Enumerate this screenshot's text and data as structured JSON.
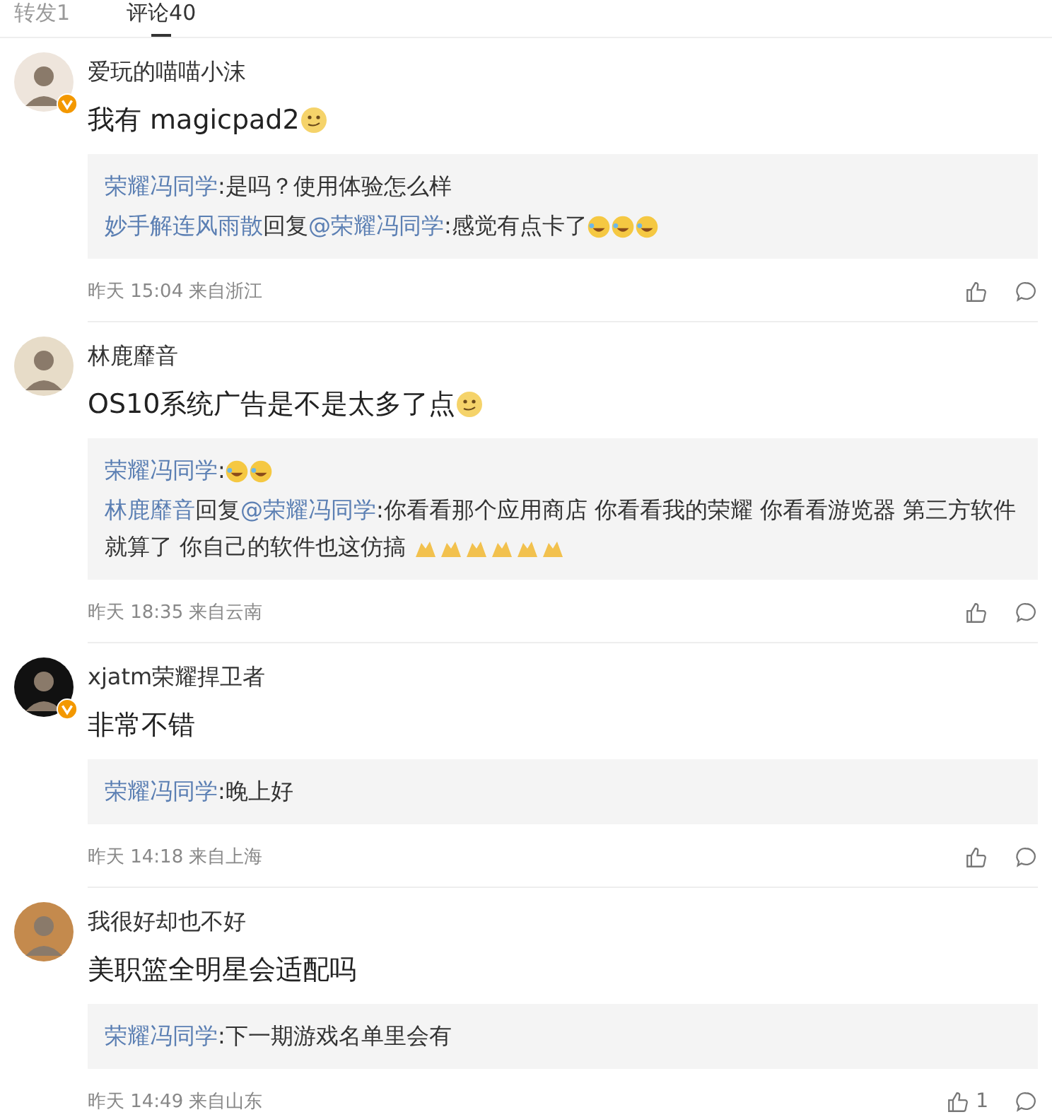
{
  "tabs": [
    {
      "label": "转发1",
      "selected": false
    },
    {
      "label": "评论40",
      "selected": true
    }
  ],
  "comments": [
    {
      "user": "爱玩的喵喵小沫",
      "verified": true,
      "avatar": {
        "color": "#eee5dc"
      },
      "text": "我有 magicpad2",
      "emojis": [
        {
          "kind": "smirk"
        }
      ],
      "replies": [
        {
          "author": "荣耀冯同学",
          "text": ":是吗？使用体验怎么样"
        },
        {
          "author": "妙手解连风雨散",
          "reply_label": "回复",
          "reply_to": "@荣耀冯同学",
          "text": ":感觉有点卡了",
          "emojis": [
            {
              "kind": "laugh"
            },
            {
              "kind": "laugh"
            },
            {
              "kind": "laugh"
            }
          ]
        }
      ],
      "meta": "昨天 15:04 来自浙江"
    },
    {
      "user": "林鹿靡音",
      "verified": false,
      "avatar": {
        "color": "#e7dcc8"
      },
      "text": "OS10系统广告是不是太多了点",
      "emojis": [
        {
          "kind": "smirk"
        }
      ],
      "replies": [
        {
          "author": "荣耀冯同学",
          "text": ":",
          "emojis": [
            {
              "kind": "laugh"
            },
            {
              "kind": "laugh"
            }
          ]
        },
        {
          "author": "林鹿靡音",
          "reply_label": "回复",
          "reply_to": "@荣耀冯同学",
          "text": ":你看看那个应用商店 你看看我的荣耀 你看看游览器 第三方软件就算了 你自己的软件也这仿搞 ",
          "emojis": [
            {
              "kind": "clap"
            },
            {
              "kind": "clap"
            },
            {
              "kind": "clap"
            },
            {
              "kind": "clap"
            },
            {
              "kind": "clap"
            },
            {
              "kind": "clap"
            }
          ]
        }
      ],
      "meta": "昨天 18:35 来自云南"
    },
    {
      "user": "xjatm荣耀捍卫者",
      "verified": true,
      "avatar": {
        "color": "#111111"
      },
      "text": "非常不错",
      "replies": [
        {
          "author": "荣耀冯同学",
          "text": ":晚上好"
        }
      ],
      "meta": "昨天 14:18 来自上海"
    },
    {
      "user": "我很好却也不好",
      "verified": false,
      "avatar": {
        "color": "#c48a4d"
      },
      "text": "美职篮全明星会适配吗",
      "replies": [
        {
          "author": "荣耀冯同学",
          "text": ":下一期游戏名单里会有"
        }
      ],
      "meta": "昨天 14:49 来自山东",
      "likes": "1"
    }
  ]
}
